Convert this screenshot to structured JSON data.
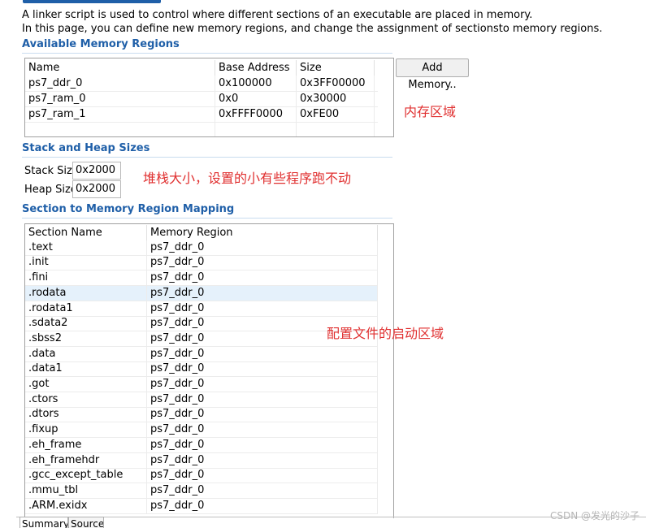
{
  "description": {
    "line1": "A linker script is used to control where different sections of an executable are placed in memory.",
    "line2": "In this page, you can define new memory regions, and change the assignment of sectionsto memory regions."
  },
  "memory": {
    "section_title": "Available Memory Regions",
    "columns": [
      "Name",
      "Base Address",
      "Size"
    ],
    "rows": [
      [
        "ps7_ddr_0",
        "0x100000",
        "0x3FF00000"
      ],
      [
        "ps7_ram_0",
        "0x0",
        "0x30000"
      ],
      [
        "ps7_ram_1",
        "0xFFFF0000",
        "0xFE00"
      ]
    ],
    "add_button": "Add Memory..",
    "annotation": "内存区域"
  },
  "stack_heap": {
    "section_title": "Stack and Heap Sizes",
    "stack_label": "Stack Size",
    "stack_value": "0x2000",
    "heap_label": "Heap Size",
    "heap_value": "0x2000",
    "annotation": "堆栈大小，设置的小有些程序跑不动"
  },
  "mapping": {
    "section_title": "Section to Memory Region Mapping",
    "columns": [
      "Section Name",
      "Memory Region"
    ],
    "selected_index": 3,
    "rows": [
      [
        ".text",
        "ps7_ddr_0"
      ],
      [
        ".init",
        "ps7_ddr_0"
      ],
      [
        ".fini",
        "ps7_ddr_0"
      ],
      [
        ".rodata",
        "ps7_ddr_0"
      ],
      [
        ".rodata1",
        "ps7_ddr_0"
      ],
      [
        ".sdata2",
        "ps7_ddr_0"
      ],
      [
        ".sbss2",
        "ps7_ddr_0"
      ],
      [
        ".data",
        "ps7_ddr_0"
      ],
      [
        ".data1",
        "ps7_ddr_0"
      ],
      [
        ".got",
        "ps7_ddr_0"
      ],
      [
        ".ctors",
        "ps7_ddr_0"
      ],
      [
        ".dtors",
        "ps7_ddr_0"
      ],
      [
        ".fixup",
        "ps7_ddr_0"
      ],
      [
        ".eh_frame",
        "ps7_ddr_0"
      ],
      [
        ".eh_framehdr",
        "ps7_ddr_0"
      ],
      [
        ".gcc_except_table",
        "ps7_ddr_0"
      ],
      [
        ".mmu_tbl",
        "ps7_ddr_0"
      ],
      [
        ".ARM.exidx",
        "ps7_ddr_0"
      ]
    ],
    "annotation": "配置文件的启动区域"
  },
  "tabs": [
    "Summary",
    "Source"
  ],
  "watermark": "CSDN @发光的沙子",
  "colors": {
    "section_title": "#1f5fa8",
    "annotation": "#e03030",
    "selected_row": "#e5f1fb"
  }
}
